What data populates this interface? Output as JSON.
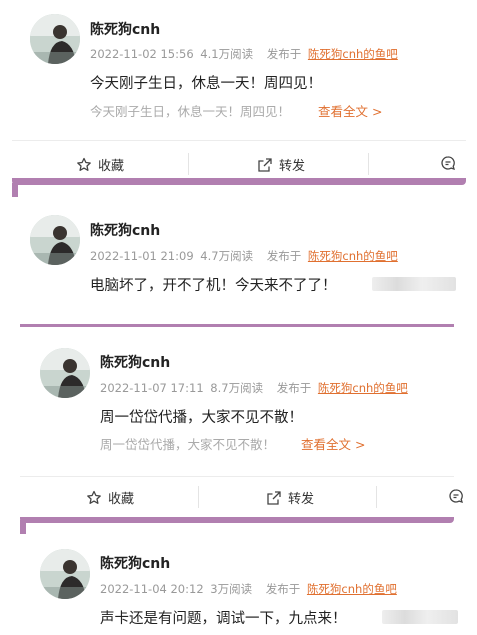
{
  "posts": [
    {
      "author": "陈死狗cnh",
      "date": "2022-11-02 15:56",
      "reads": "4.1万阅读",
      "published_in": "发布于",
      "source": "陈死狗cnh的鱼吧",
      "text": "今天刚子生日，休息一天！周四见！",
      "preview": "今天刚子生日，休息一天！周四见！",
      "read_more": "查看全文 >"
    },
    {
      "author": "陈死狗cnh",
      "date": "2022-11-01 21:09",
      "reads": "4.7万阅读",
      "published_in": "发布于",
      "source": "陈死狗cnh的鱼吧",
      "text": "电脑坏了，开不了机！今天来不了了！"
    },
    {
      "author": "陈死狗cnh",
      "date": "2022-11-07 17:11",
      "reads": "8.7万阅读",
      "published_in": "发布于",
      "source": "陈死狗cnh的鱼吧",
      "text": "周一岱岱代播，大家不见不散！",
      "preview": "周一岱岱代播，大家不见不散！",
      "read_more": "查看全文 >"
    },
    {
      "author": "陈死狗cnh",
      "date": "2022-11-04 20:12",
      "reads": "3万阅读",
      "published_in": "发布于",
      "source": "陈死狗cnh的鱼吧",
      "text": "声卡还是有问题，调试一下，九点来！"
    }
  ],
  "actions": {
    "favorite": "收藏",
    "share": "转发"
  },
  "icons": [
    "star-icon",
    "share-icon",
    "comment-icon"
  ],
  "colors": {
    "accent": "#e07030",
    "divider": "#b17fb0",
    "meta": "#999999"
  }
}
